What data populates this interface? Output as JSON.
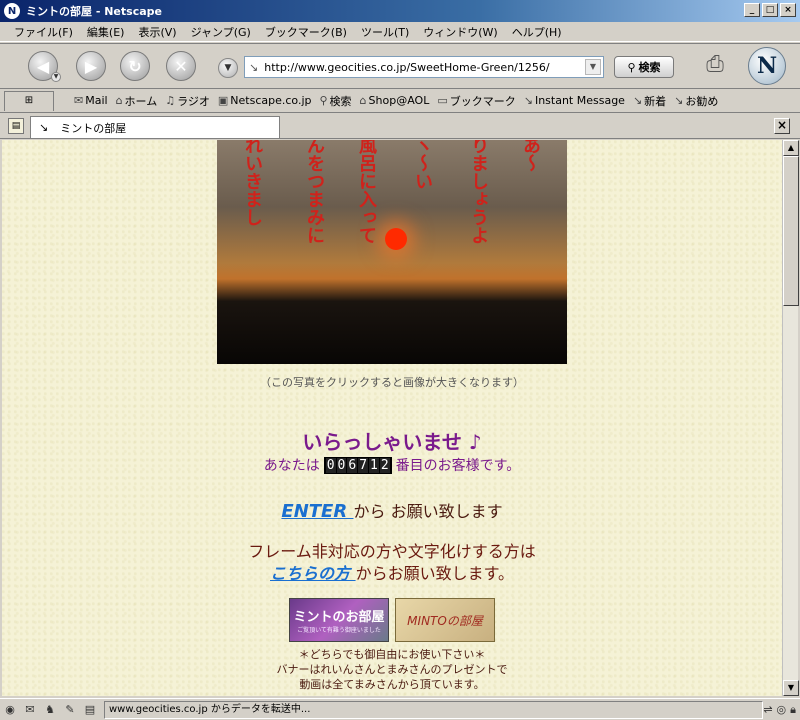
{
  "window": {
    "title": "ミントの部屋 - Netscape",
    "app_badge": "N"
  },
  "window_controls": {
    "minimize": "_",
    "maximize": "□",
    "close": "×"
  },
  "menu": [
    "ファイル(F)",
    "編集(E)",
    "表示(V)",
    "ジャンプ(G)",
    "ブックマーク(B)",
    "ツール(T)",
    "ウィンドウ(W)",
    "ヘルプ(H)"
  ],
  "nav": {
    "url": "http://www.geocities.co.jp/SweetHome-Green/1256/",
    "search_label": "検索",
    "logo": "N"
  },
  "bookmarks": [
    {
      "label": "Mail",
      "icon": "mail-icon",
      "glyph": "✉"
    },
    {
      "label": "ホーム",
      "icon": "home-icon",
      "glyph": "⌂"
    },
    {
      "label": "ラジオ",
      "icon": "headphones-icon",
      "glyph": "♫"
    },
    {
      "label": "Netscape.co.jp",
      "icon": "my-icon",
      "glyph": "▣"
    },
    {
      "label": "検索",
      "icon": "search-icon",
      "glyph": "⚲"
    },
    {
      "label": "Shop@AOL",
      "icon": "shop-icon",
      "glyph": "⌂"
    },
    {
      "label": "ブックマーク",
      "icon": "folder-icon",
      "glyph": "▭"
    },
    {
      "label": "Instant Message",
      "icon": "link-icon",
      "glyph": "↘"
    },
    {
      "label": "新着",
      "icon": "link-icon",
      "glyph": "↘"
    },
    {
      "label": "お勧め",
      "icon": "link-icon",
      "glyph": "↘"
    }
  ],
  "tab": {
    "label": "ミントの部屋"
  },
  "content": {
    "photo_text": [
      "れいきまし",
      "んをつまみに",
      "風呂に入って",
      "ヽ〜い",
      "りましょうよ",
      "あ〜"
    ],
    "photo_caption": "（この写真をクリックすると画像が大きくなります）",
    "welcome": "いらっしゃいませ ♪",
    "visitor_prefix": "あなたは",
    "counter_digits": [
      "0",
      "0",
      "6",
      "7",
      "1",
      "2"
    ],
    "visitor_suffix": "番目のお客様です。",
    "enter_link": "ENTER ",
    "enter_suffix": "から お願い致します",
    "frame_line1": "フレーム非対応の方や文字化けする方は",
    "kochira_link": "こちらの方 ",
    "frame_line2_suffix": "からお願い致します。",
    "banner1_title": "ミントのお部屋",
    "banner1_sub": "ご覧頂いて有難う御座いました",
    "banner2_title": "MINTOの部屋",
    "notes": [
      "＊どちらでも御自由にお使い下さい＊",
      "バナーはれいんさんとまみさんのプレゼントで",
      "動画は全てまみさんから頂ています。"
    ]
  },
  "status": {
    "text": "www.geocities.co.jp からデータを転送中..."
  }
}
